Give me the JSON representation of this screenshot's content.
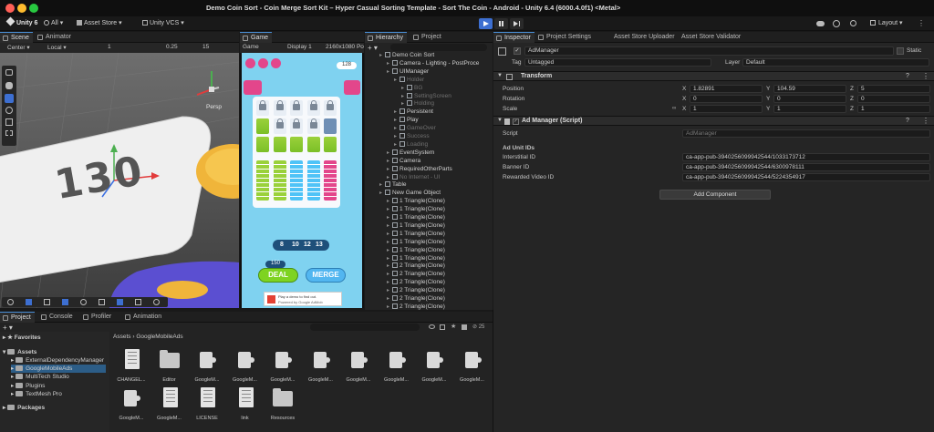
{
  "window": {
    "title": "Demo Coin Sort - Coin Merge Sort Kit – Hyper Casual Sorting Template - Sort The Coin - Android - Unity 6.4 (6000.4.0f1) <Metal>",
    "traffic_colors": [
      "#ff5f57",
      "#febc2e",
      "#28c840"
    ]
  },
  "toolbar": {
    "unity_version": "Unity 6",
    "all_label": "All",
    "asset_store": "Asset Store",
    "vcs": "Unity VCS",
    "layout": "Layout",
    "accent": "#3d6fd1"
  },
  "scene": {
    "tabs": [
      "Scene",
      "Animator"
    ],
    "center": "Center",
    "local": "Local",
    "grid_count": "1",
    "snap_value": "0.25",
    "camera_count": "15",
    "persp": "Persp",
    "number_3d": "130"
  },
  "game": {
    "tab": "Game",
    "display": "Game",
    "display_num": "Display 1",
    "resolution": "2160x1080 Po",
    "coin_count": "128",
    "numbers": [
      "8",
      "10",
      "12",
      "13"
    ],
    "deal_badge": "150",
    "deal": "DEAL",
    "merge": "MERGE",
    "ad_text": "Play a demo to find out.",
    "ad_sub": "Powered by Google AdMob"
  },
  "hierarchy": {
    "tabs": [
      "Hierarchy",
      "Project"
    ],
    "items": [
      {
        "text": "Demo Coin Sort",
        "dim": false
      },
      {
        "text": "Camera - Lighting - PostProce",
        "dim": false
      },
      {
        "text": "UIManager",
        "dim": false
      },
      {
        "text": "Holder",
        "dim": true
      },
      {
        "text": "BG",
        "dim": true
      },
      {
        "text": "SettingScreen",
        "dim": true
      },
      {
        "text": "Holding",
        "dim": true
      },
      {
        "text": "Persistent",
        "dim": false
      },
      {
        "text": "Play",
        "dim": false
      },
      {
        "text": "GameOver",
        "dim": true
      },
      {
        "text": "Success",
        "dim": true
      },
      {
        "text": "Loading",
        "dim": true
      },
      {
        "text": "EventSystem",
        "dim": false
      },
      {
        "text": "Camera",
        "dim": false
      },
      {
        "text": "RequiredOtherParts",
        "dim": false
      },
      {
        "text": "No Internet - UI",
        "dim": true
      },
      {
        "text": "Table",
        "dim": false
      },
      {
        "text": "New Game Object",
        "dim": false
      },
      {
        "text": "1 Triangle(Clone)",
        "dim": false
      },
      {
        "text": "1 Triangle(Clone)",
        "dim": false
      },
      {
        "text": "1 Triangle(Clone)",
        "dim": false
      },
      {
        "text": "1 Triangle(Clone)",
        "dim": false
      },
      {
        "text": "1 Triangle(Clone)",
        "dim": false
      },
      {
        "text": "1 Triangle(Clone)",
        "dim": false
      },
      {
        "text": "1 Triangle(Clone)",
        "dim": false
      },
      {
        "text": "1 Triangle(Clone)",
        "dim": false
      },
      {
        "text": "2 Triangle(Clone)",
        "dim": false
      },
      {
        "text": "2 Triangle(Clone)",
        "dim": false
      },
      {
        "text": "2 Triangle(Clone)",
        "dim": false
      },
      {
        "text": "2 Triangle(Clone)",
        "dim": false
      },
      {
        "text": "2 Triangle(Clone)",
        "dim": false
      },
      {
        "text": "2 Triangle(Clone)",
        "dim": false
      }
    ]
  },
  "inspector": {
    "tabs": [
      "Inspector",
      "Project Settings",
      "Asset Store Uploader",
      "Asset Store Validator"
    ],
    "object_name": "AdManager",
    "static": "Static",
    "tag_label": "Tag",
    "tag": "Untagged",
    "layer_label": "Layer",
    "layer": "Default",
    "transform_title": "Transform",
    "position_label": "Position",
    "rotation_label": "Rotation",
    "scale_label": "Scale",
    "position": {
      "x": "1.82891",
      "y": "104.59",
      "z": "5"
    },
    "rotation": {
      "x": "0",
      "y": "0",
      "z": "0"
    },
    "scale": {
      "x": "1",
      "y": "1",
      "z": "1"
    },
    "component_title": "Ad Manager (Script)",
    "script_label": "Script",
    "script_value": "AdManager",
    "ad_ids_header": "Ad Unit IDs",
    "interstitial_label": "Interstitial ID",
    "interstitial_value": "ca-app-pub-3940256099942544/1033173712",
    "banner_label": "Banner ID",
    "banner_value": "ca-app-pub-3940256099942544/6300978111",
    "rewarded_label": "Rewarded Video ID",
    "rewarded_value": "ca-app-pub-3940256099942544/5224354917",
    "add_component": "Add Component"
  },
  "project": {
    "tabs": [
      "Project",
      "Console",
      "Profiler",
      "Animation"
    ],
    "count": "25",
    "breadcrumb_root": "Assets",
    "breadcrumb_current": "GoogleMobileAds",
    "favorites": "Favorites",
    "assets": "Assets",
    "tree": [
      "ExternalDependencyManager",
      "GoogleMobileAds",
      "MultiTech Studio",
      "Plugins",
      "TextMesh Pro"
    ],
    "packages": "Packages",
    "files_row1": [
      {
        "name": "CHANGEL...",
        "kind": "doc"
      },
      {
        "name": "Editor",
        "kind": "folder"
      },
      {
        "name": "GoogleM...",
        "kind": "puzzle"
      },
      {
        "name": "GoogleM...",
        "kind": "puzzle"
      },
      {
        "name": "GoogleM...",
        "kind": "puzzle"
      },
      {
        "name": "GoogleM...",
        "kind": "puzzle"
      },
      {
        "name": "GoogleM...",
        "kind": "puzzle"
      },
      {
        "name": "GoogleM...",
        "kind": "puzzle"
      },
      {
        "name": "GoogleM...",
        "kind": "puzzle"
      },
      {
        "name": "GoogleM...",
        "kind": "puzzle"
      }
    ],
    "files_row2": [
      {
        "name": "GoogleM...",
        "kind": "puzzle"
      },
      {
        "name": "GoogleM...",
        "kind": "doc"
      },
      {
        "name": "LICENSE",
        "kind": "doc"
      },
      {
        "name": "link",
        "kind": "doc"
      },
      {
        "name": "Resources",
        "kind": "folder"
      }
    ]
  }
}
